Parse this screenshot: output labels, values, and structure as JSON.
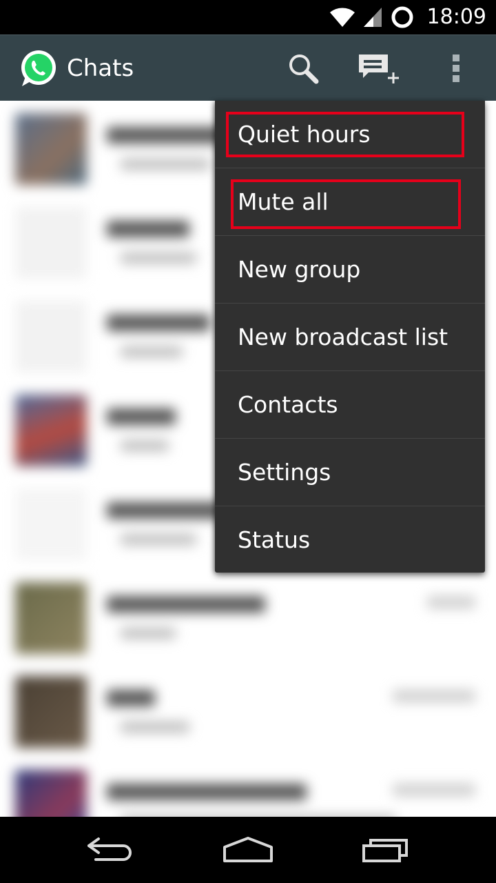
{
  "status_bar": {
    "time": "18:09",
    "icons": [
      "wifi-icon",
      "signal-icon",
      "sync-ring-icon"
    ]
  },
  "action_bar": {
    "app_icon": "whatsapp-logo-icon",
    "title": "Chats",
    "actions": [
      "search-icon",
      "new-chat-icon",
      "overflow-menu-icon"
    ]
  },
  "overflow_menu": {
    "items": [
      {
        "label": "Quiet hours",
        "highlighted": true
      },
      {
        "label": "Mute all",
        "highlighted": true
      },
      {
        "label": "New group",
        "highlighted": false
      },
      {
        "label": "New broadcast list",
        "highlighted": false
      },
      {
        "label": "Contacts",
        "highlighted": false
      },
      {
        "label": "Settings",
        "highlighted": false
      },
      {
        "label": "Status",
        "highlighted": false
      }
    ]
  },
  "navigation_bar": {
    "buttons": [
      "back-icon",
      "home-icon",
      "recents-icon"
    ]
  },
  "colors": {
    "action_bar": "#34444a",
    "menu_background": "#303030",
    "highlight": "#e6001a",
    "brand_green": "#25d366"
  }
}
